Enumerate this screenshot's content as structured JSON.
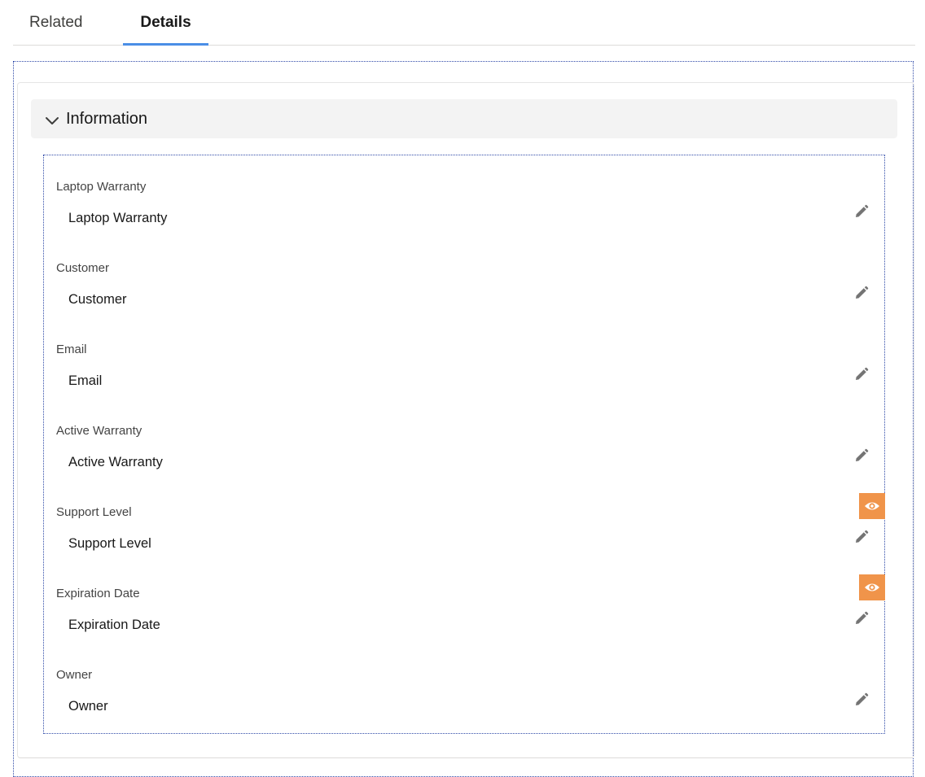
{
  "tabs": [
    {
      "label": "Related",
      "active": false
    },
    {
      "label": "Details",
      "active": true
    }
  ],
  "section": {
    "title": "Information",
    "expanded": true
  },
  "fields": [
    {
      "label": "Laptop Warranty",
      "value": "Laptop Warranty",
      "visibility_icon": false
    },
    {
      "label": "Customer",
      "value": "Customer",
      "visibility_icon": false
    },
    {
      "label": "Email",
      "value": "Email",
      "visibility_icon": false
    },
    {
      "label": "Active Warranty",
      "value": "Active Warranty",
      "visibility_icon": false
    },
    {
      "label": "Support Level",
      "value": "Support Level",
      "visibility_icon": true
    },
    {
      "label": "Expiration Date",
      "value": "Expiration Date",
      "visibility_icon": true
    },
    {
      "label": "Owner",
      "value": "Owner",
      "visibility_icon": false
    }
  ],
  "icons": {
    "section_toggle": "chevron-down-icon",
    "edit": "pencil-icon",
    "visibility": "eye-icon"
  },
  "colors": {
    "active_tab_underline": "#4a8ee6",
    "visibility_badge": "#f0944a",
    "section_header_bg": "#f3f3f3"
  }
}
